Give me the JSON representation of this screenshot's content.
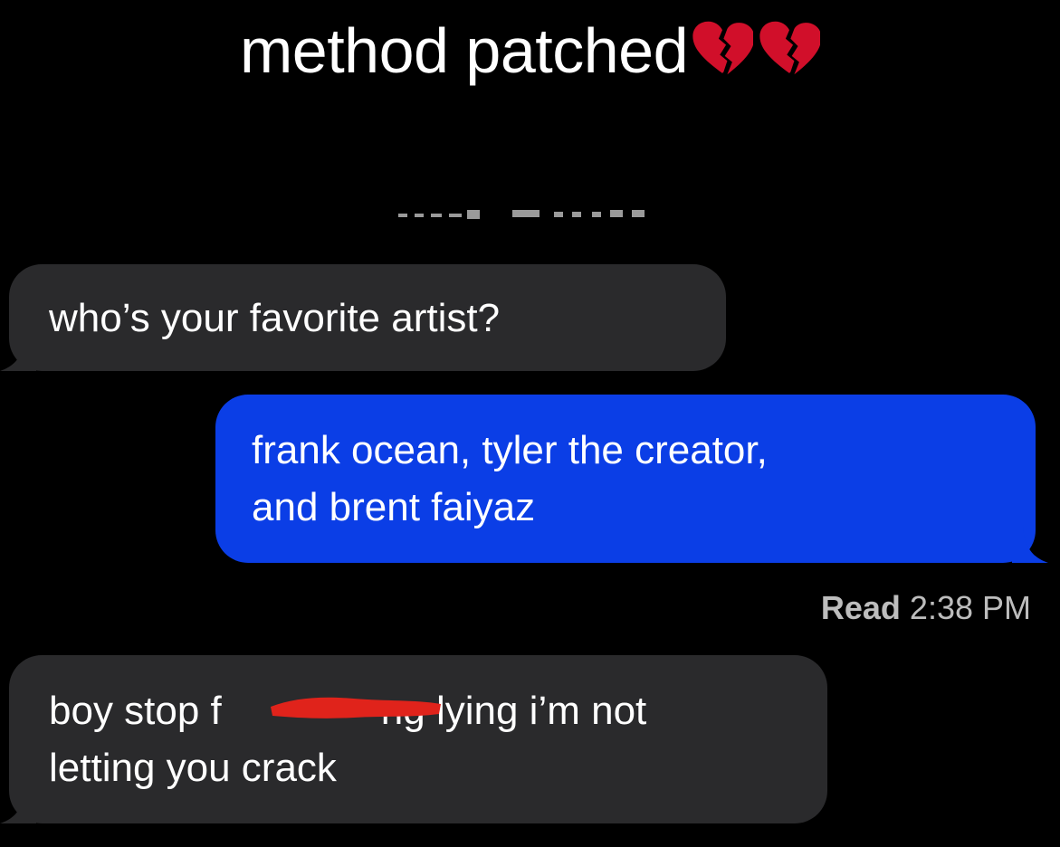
{
  "caption": {
    "text": "method patched",
    "emoji": [
      "broken-heart-icon",
      "broken-heart-icon"
    ],
    "emoji_color": "#d10f2a"
  },
  "conversation": {
    "messages": [
      {
        "direction": "incoming",
        "text": "who’s your favorite artist?"
      },
      {
        "direction": "outgoing",
        "text": "frank ocean, tyler the creator,\nand brent faiyaz"
      },
      {
        "direction": "incoming",
        "text": "boy stop f    ng lying i’m not\nletting you crack"
      }
    ],
    "receipt": {
      "label": "Read",
      "time": "2:38 PM"
    }
  },
  "colors": {
    "background": "#000000",
    "incoming_bubble": "#2a2a2c",
    "outgoing_bubble": "#0b3ee6",
    "redaction": "#e0231b"
  }
}
